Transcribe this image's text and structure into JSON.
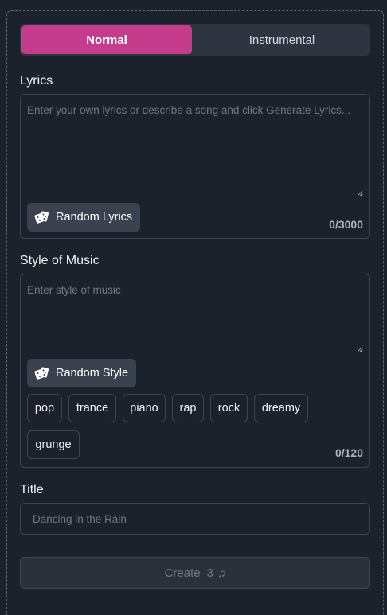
{
  "mode_toggle": {
    "normal_label": "Normal",
    "instrumental_label": "Instrumental",
    "selected": "Normal"
  },
  "lyrics": {
    "label": "Lyrics",
    "placeholder": "Enter your own lyrics or describe a song and click Generate Lyrics...",
    "value": "",
    "random_button_label": "Random Lyrics",
    "random_button_icon": "dice-icon",
    "counter": "0/3000"
  },
  "style": {
    "label": "Style of Music",
    "placeholder": "Enter style of music",
    "value": "",
    "random_button_label": "Random Style",
    "random_button_icon": "dice-icon",
    "tags": [
      "pop",
      "trance",
      "piano",
      "rap",
      "rock",
      "dreamy",
      "grunge"
    ],
    "counter": "0/120"
  },
  "title": {
    "label": "Title",
    "placeholder": "Dancing in the Rain",
    "value": ""
  },
  "create": {
    "label": "Create",
    "credits": "3",
    "icon": "music-note-icon"
  },
  "colors": {
    "accent": "#c63c8d",
    "background": "#1b222c",
    "border": "#3d4553"
  }
}
